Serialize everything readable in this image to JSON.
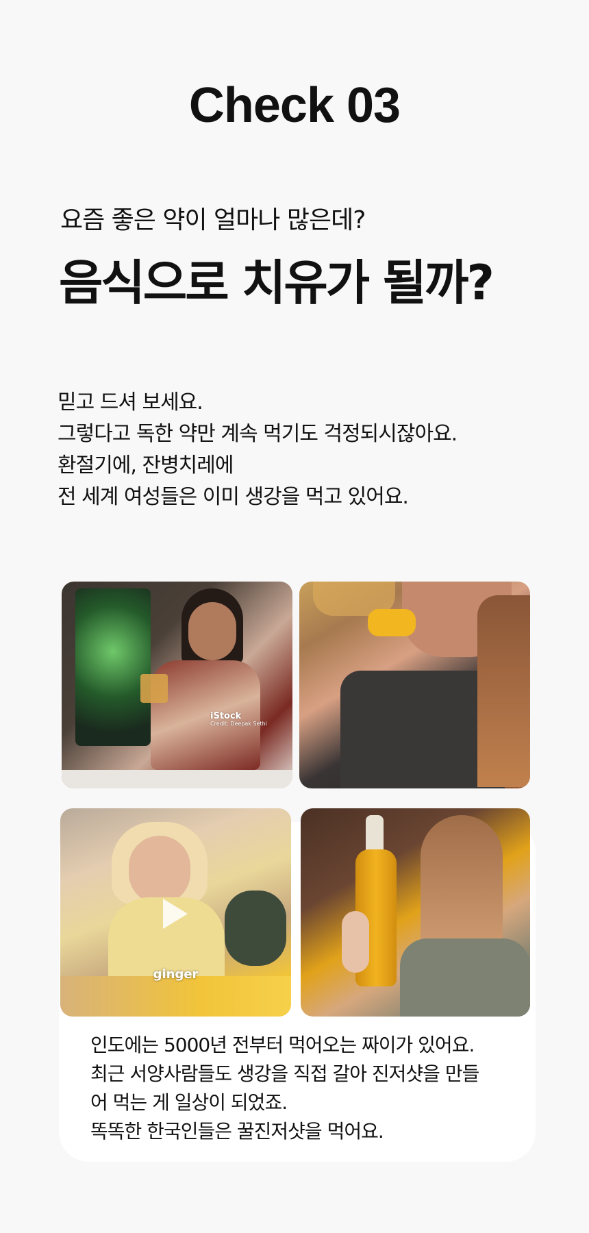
{
  "title": "Check 03",
  "sub_question": "요즘 좋은 약이 얼마나 많은데?",
  "headline": "음식으로 치유가 될까?",
  "body_lines": [
    "믿고 드셔 보세요.",
    "그렇다고 독한 약만 계속 먹기도 걱정되시잖아요.",
    "환절기에, 잔병치레에",
    "전 세계 여성들은 이미 생강을 먹고 있어요."
  ],
  "photos": {
    "p1_watermark": "iStock",
    "p1_credit": "Credit: Deepak Sethi",
    "p3_label": "ginger"
  },
  "card_lines": [
    "인도에는 5000년 전부터 먹어오는 짜이가 있어요.",
    "최근 서양사람들도 생강을 직접 갈아 진저샷을 만들",
    "어 먹는 게 일상이 되었죠.",
    "똑똑한 한국인들은 꿀진저샷을 먹어요."
  ]
}
